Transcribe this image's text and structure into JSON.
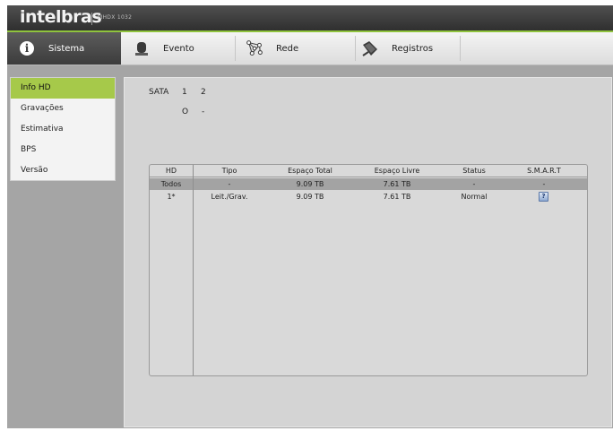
{
  "brand": {
    "logo": "intelbras",
    "model": "MHDX 1032"
  },
  "nav": [
    {
      "label": "Sistema",
      "icon": "info-icon",
      "active": true
    },
    {
      "label": "Evento",
      "icon": "alarm-light-icon",
      "active": false
    },
    {
      "label": "Rede",
      "icon": "network-icon",
      "active": false
    },
    {
      "label": "Registros",
      "icon": "records-icon",
      "active": false
    }
  ],
  "sidebar": {
    "items": [
      {
        "label": "Info HD",
        "active": true
      },
      {
        "label": "Gravações",
        "active": false
      },
      {
        "label": "Estimativa",
        "active": false
      },
      {
        "label": "BPS",
        "active": false
      },
      {
        "label": "Versão",
        "active": false
      }
    ]
  },
  "sata": {
    "label": "SATA",
    "indexes": [
      "1",
      "2"
    ],
    "statuses": [
      "O",
      "-"
    ]
  },
  "table": {
    "headers": [
      "HD",
      "Tipo",
      "Espaço Total",
      "Espaço Livre",
      "Status",
      "S.M.A.R.T"
    ],
    "rows": [
      {
        "hd": "Todos",
        "tipo": "-",
        "total": "9.09 TB",
        "livre": "7.61 TB",
        "status": "-",
        "smart": "-",
        "selected": true
      },
      {
        "hd": "1*",
        "tipo": "Leit./Grav.",
        "total": "9.09 TB",
        "livre": "7.61 TB",
        "status": "Normal",
        "smart_icon": "smart-status-icon",
        "selected": false
      }
    ]
  },
  "colors": {
    "accent": "#a6c94a",
    "header": "#3c3c3c",
    "background": "#a5a5a5"
  }
}
